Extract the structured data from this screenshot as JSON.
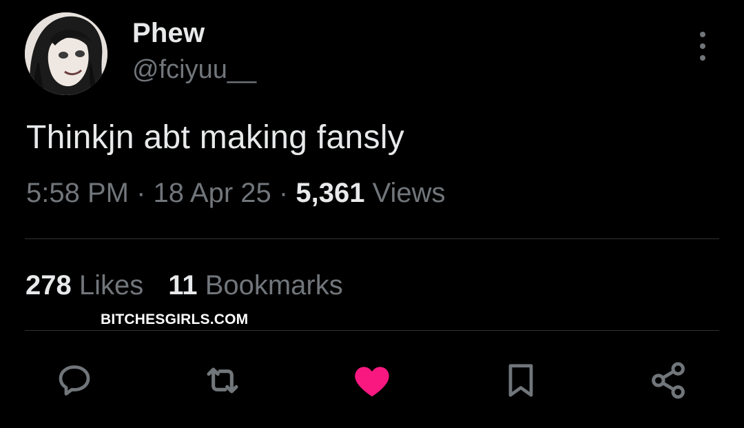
{
  "user": {
    "display_name": "Phew",
    "handle": "@fciyuu__"
  },
  "tweet": {
    "text": "Thinkjn abt making fansly",
    "time": "5:58 PM",
    "date": "18 Apr 25",
    "views_count": "5,361",
    "views_label": "Views"
  },
  "stats": {
    "likes_count": "278",
    "likes_label": "Likes",
    "bookmarks_count": "11",
    "bookmarks_label": "Bookmarks"
  },
  "watermark": "BITCHESGIRLS.COM",
  "icons": {
    "avatar": "avatar-image",
    "more": "more-vertical-icon",
    "reply": "reply-icon",
    "retweet": "retweet-icon",
    "like": "heart-icon",
    "bookmark": "bookmark-icon",
    "share": "share-icon"
  },
  "colors": {
    "background": "#000000",
    "text": "#e7e9ea",
    "secondary_text": "#71767b",
    "like_active": "#f91880",
    "divider": "#2f3336"
  }
}
